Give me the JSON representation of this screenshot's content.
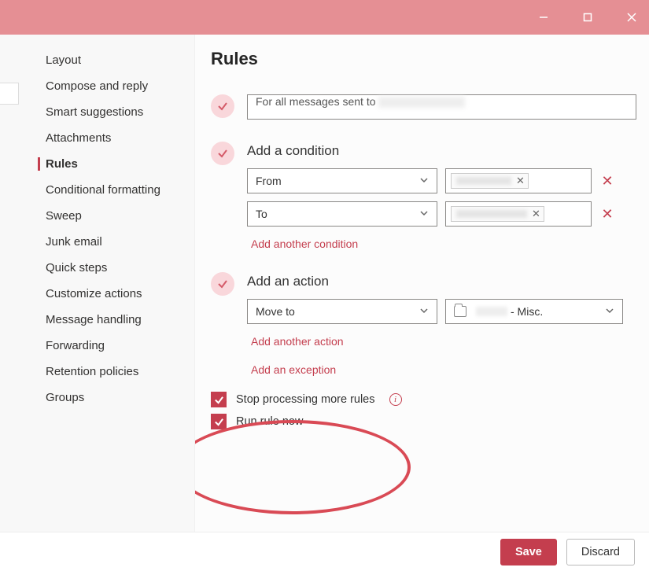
{
  "titlebar": {
    "minimize": "minimize",
    "maximize": "maximize",
    "close": "close"
  },
  "sidebar": {
    "items": [
      {
        "label": "Layout",
        "active": false
      },
      {
        "label": "Compose and reply",
        "active": false
      },
      {
        "label": "Smart suggestions",
        "active": false
      },
      {
        "label": "Attachments",
        "active": false
      },
      {
        "label": "Rules",
        "active": true
      },
      {
        "label": "Conditional formatting",
        "active": false
      },
      {
        "label": "Sweep",
        "active": false
      },
      {
        "label": "Junk email",
        "active": false
      },
      {
        "label": "Quick steps",
        "active": false
      },
      {
        "label": "Customize actions",
        "active": false
      },
      {
        "label": "Message handling",
        "active": false
      },
      {
        "label": "Forwarding",
        "active": false
      },
      {
        "label": "Retention policies",
        "active": false
      },
      {
        "label": "Groups",
        "active": false
      }
    ]
  },
  "main": {
    "title": "Rules",
    "rule_name_prefix": "For all messages sent to",
    "add_condition_title": "Add a condition",
    "conditions": [
      {
        "type_label": "From"
      },
      {
        "type_label": "To"
      }
    ],
    "add_another_condition": "Add another condition",
    "add_action_title": "Add an action",
    "actions": [
      {
        "type_label": "Move to",
        "target_suffix": " - Misc."
      }
    ],
    "add_another_action": "Add another action",
    "add_exception": "Add an exception",
    "stop_processing": "Stop processing more rules",
    "run_rule_now": "Run rule now"
  },
  "footer": {
    "save": "Save",
    "discard": "Discard"
  }
}
